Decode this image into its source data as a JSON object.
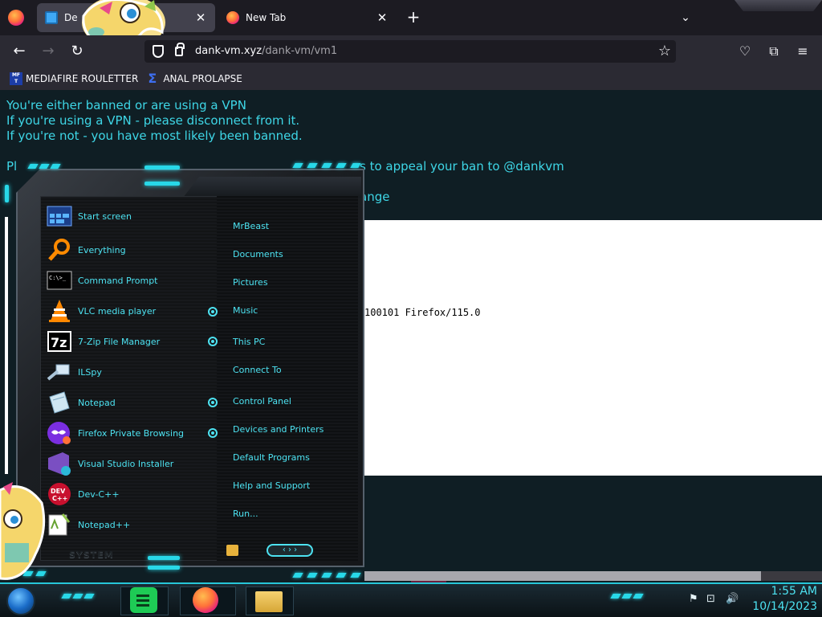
{
  "browser": {
    "tabs": [
      {
        "label": "De",
        "icon": "monitor-icon",
        "active": true
      },
      {
        "label": "New Tab",
        "icon": "firefox-icon",
        "active": false
      }
    ],
    "url": {
      "host": "dank-vm.xyz",
      "path": "/dank-vm/vm1"
    },
    "bookmarks": [
      {
        "label": "MEDIAFIRE ROULETTER",
        "icon": "mediafire-icon"
      },
      {
        "label": "ANAL PROLAPSE",
        "icon": "sigma-icon"
      }
    ]
  },
  "page": {
    "lines": [
      "You're either banned or are using a VPN",
      "If you're using a VPN - please disconnect from it.",
      "If you're not - you have most likely been banned.",
      "Pl",
      "s to appeal your ban to @dankvm",
      "ange"
    ],
    "user_agent_fragment": "100101 Firefox/115.0"
  },
  "start_menu": {
    "programs": [
      {
        "label": "Start screen",
        "icon": "start-screen-icon"
      },
      {
        "label": "Everything",
        "icon": "magnifier-icon"
      },
      {
        "label": "Command Prompt",
        "icon": "cmd-icon",
        "icon_text": "C:\\>_"
      },
      {
        "label": "VLC media player",
        "icon": "vlc-cone-icon"
      },
      {
        "label": "7-Zip File Manager",
        "icon": "7zip-icon",
        "icon_text": "7z"
      },
      {
        "label": "ILSpy",
        "icon": "ilspy-icon"
      },
      {
        "label": "Notepad",
        "icon": "notepad-icon"
      },
      {
        "label": "Firefox Private Browsing",
        "icon": "private-browsing-icon"
      },
      {
        "label": "Visual Studio Installer",
        "icon": "vs-installer-icon"
      },
      {
        "label": "Dev-C++",
        "icon": "devcpp-icon",
        "icon_text": "DEV C++"
      },
      {
        "label": "Notepad++",
        "icon": "notepadpp-icon"
      }
    ],
    "places": [
      {
        "label": "MrBeast",
        "has_arrow": false
      },
      {
        "label": "Documents",
        "has_arrow": false
      },
      {
        "label": "Pictures",
        "has_arrow": false
      },
      {
        "label": "Music",
        "has_arrow": true
      },
      {
        "label": "This PC",
        "has_arrow": true
      },
      {
        "label": "Connect To",
        "has_arrow": false
      },
      {
        "label": "Control Panel",
        "has_arrow": true
      },
      {
        "label": "Devices and Printers",
        "has_arrow": true
      },
      {
        "label": "Default Programs",
        "has_arrow": false
      },
      {
        "label": "Help and Support",
        "has_arrow": false
      },
      {
        "label": "Run...",
        "has_arrow": false
      }
    ],
    "system_label": "SYSTEM",
    "nav_arrows": "‹ › ›"
  },
  "taskbar": {
    "time": "1:55 AM",
    "date": "10/14/2023",
    "tray_icons": [
      "flag-icon",
      "network-icon",
      "volume-icon"
    ]
  },
  "colors": {
    "accent_cyan": "#4de3f2",
    "page_text": "#3ed6e6",
    "page_bg": "#0f1e24"
  }
}
